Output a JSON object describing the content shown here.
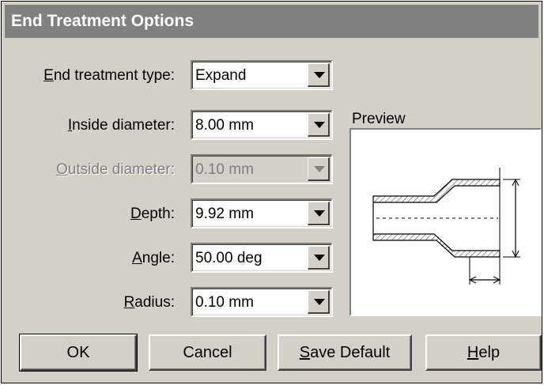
{
  "dialog": {
    "title": "End Treatment Options"
  },
  "fields": {
    "end_treatment_type": {
      "label_u": "E",
      "label_rest": "nd treatment type:",
      "value": "Expand"
    },
    "inside_diameter": {
      "label_u": "I",
      "label_rest": "nside diameter:",
      "value": "8.00 mm"
    },
    "outside_diameter": {
      "label_u": "O",
      "label_rest": "utside diameter:",
      "value": "0.10 mm",
      "disabled": true
    },
    "depth": {
      "label_u": "D",
      "label_rest": "epth:",
      "value": "9.92 mm"
    },
    "angle": {
      "label_u": "A",
      "label_rest": "ngle:",
      "value": "50.00 deg"
    },
    "radius": {
      "label_u": "R",
      "label_rest": "adius:",
      "value": "0.10 mm"
    }
  },
  "preview": {
    "label": "Preview"
  },
  "buttons": {
    "ok": "OK",
    "cancel": "Cancel",
    "save_default_u": "S",
    "save_default_rest": "ave Default",
    "help_u": "H",
    "help_rest": "elp"
  },
  "icons": {
    "dropdown": "chevron-down-icon"
  }
}
